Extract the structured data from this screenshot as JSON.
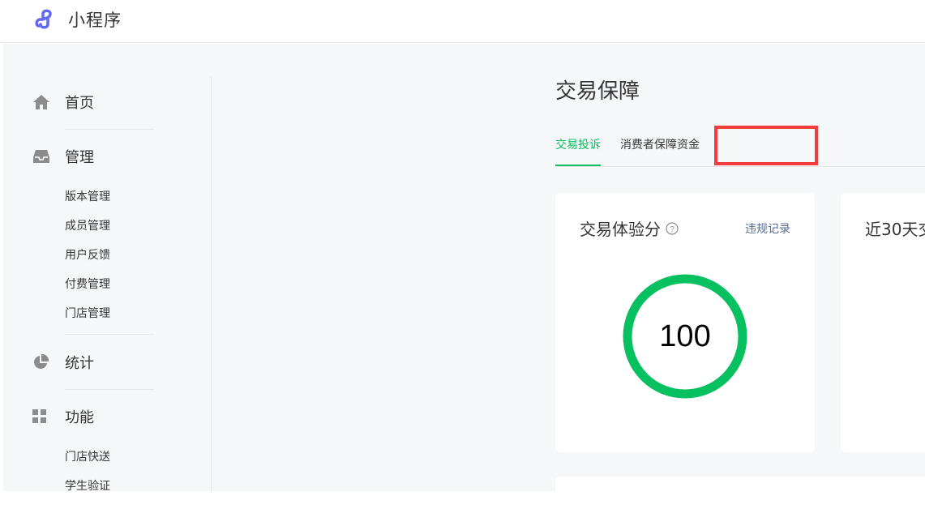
{
  "topbar": {
    "app_title": "小程序",
    "logo_icon": "miniprogram-logo-icon",
    "accent_color": "#6467f0"
  },
  "sidebar": {
    "groups": [
      {
        "label": "首页",
        "icon": "home-icon"
      },
      {
        "label": "管理",
        "icon": "inbox-icon",
        "items": [
          "版本管理",
          "成员管理",
          "用户反馈",
          "付费管理",
          "门店管理"
        ]
      },
      {
        "label": "统计",
        "icon": "pie-chart-icon"
      },
      {
        "label": "功能",
        "icon": "grid-icon",
        "items": [
          "门店快送",
          "学生验证"
        ]
      }
    ]
  },
  "main": {
    "page_title": "交易保障",
    "tabs": [
      {
        "label": "交易投诉",
        "active": true
      },
      {
        "label": "消费者保障资金",
        "active": false
      },
      {
        "label": "",
        "active": false,
        "highlighted": true
      }
    ],
    "score_card": {
      "title": "交易体验分",
      "help_icon": "question-circle-icon",
      "link": "违规记录",
      "score": "100",
      "score_fraction": 1.0
    },
    "trend_card": {
      "title": "近30天交"
    }
  },
  "colors": {
    "active_green": "#07c160",
    "link_blue": "#576b95",
    "highlight_red": "#f23d3d",
    "page_background": "#f6f7f9"
  }
}
